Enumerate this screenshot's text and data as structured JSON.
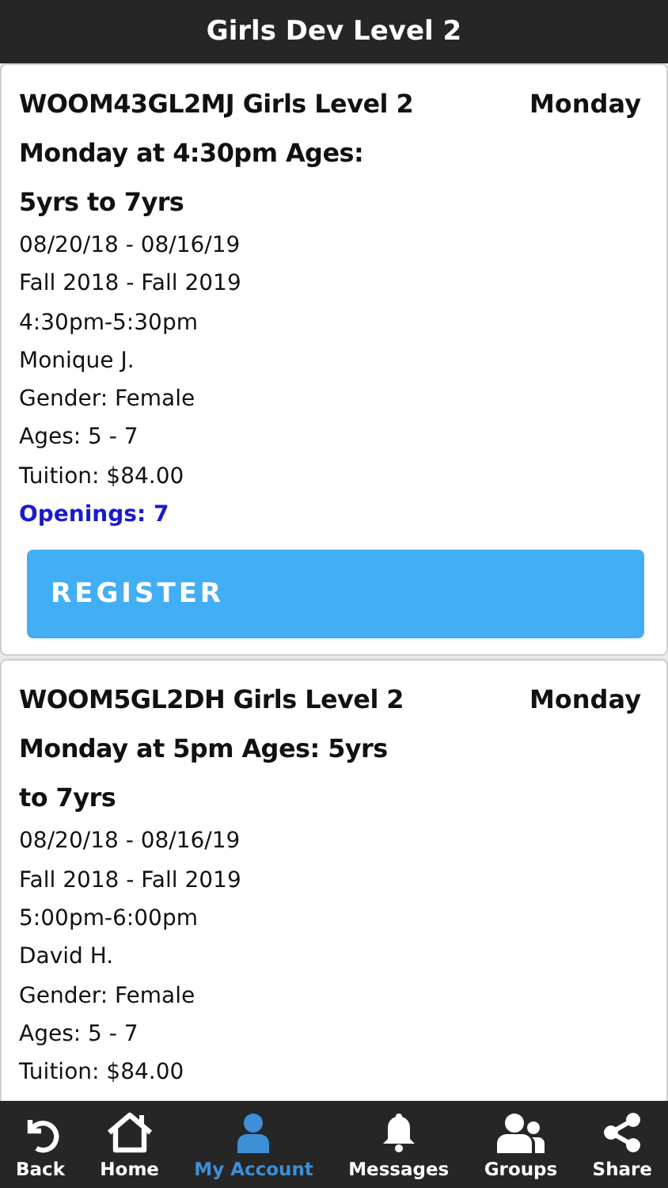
{
  "header": {
    "title": "Girls Dev Level 2"
  },
  "classes": [
    {
      "title": "WOOM43GL2MJ Girls Level 2 Monday at 4:30pm Ages: 5yrs to 7yrs",
      "day": "Monday",
      "details": [
        "08/20/18 - 08/16/19",
        "Fall 2018 - Fall 2019",
        "4:30pm-5:30pm",
        "Monique J.",
        "Gender: Female",
        "Ages: 5 - 7",
        "Tuition: $84.00"
      ],
      "openings": "Openings: 7",
      "button": "REGISTER"
    },
    {
      "title": "WOOM5GL2DH Girls Level 2 Monday at 5pm Ages: 5yrs to 7yrs",
      "day": "Monday",
      "details": [
        "08/20/18 - 08/16/19",
        "Fall 2018 - Fall 2019",
        "5:00pm-6:00pm",
        "David H.",
        "Gender: Female",
        "Ages: 5 - 7",
        "Tuition: $84.00"
      ]
    }
  ],
  "tabs": [
    {
      "kind": "back",
      "label": "Back",
      "selected": false
    },
    {
      "kind": "home",
      "label": "Home",
      "selected": false
    },
    {
      "kind": "account",
      "label": "My Account",
      "selected": true
    },
    {
      "kind": "messages",
      "label": "Messages",
      "selected": false
    },
    {
      "kind": "groups",
      "label": "Groups",
      "selected": false
    },
    {
      "kind": "share",
      "label": "Share",
      "selected": false
    }
  ]
}
